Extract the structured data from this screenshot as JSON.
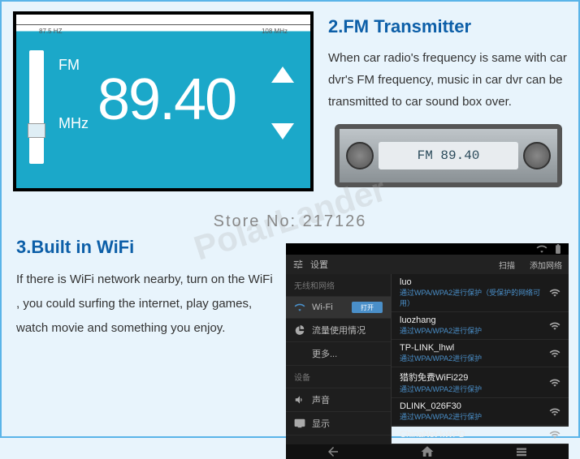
{
  "fm": {
    "title": "2.FM Transmitter",
    "text": "When car radio's frequency is same with car dvr's FM frequency, music in car dvr can be transmitted to car sound box over.",
    "scale_min": "87.5 HZ",
    "scale_max": "108 MHz",
    "label_fm": "FM",
    "label_mhz": "MHz",
    "freq": "89.40"
  },
  "stereo": {
    "disp": "FM 89.40"
  },
  "store": "Store No: 217126",
  "watermark": "PolarLander",
  "wifi": {
    "title": "3.Built in WiFi",
    "text": "If there is WiFi network nearby, turn on the WiFi , you could surfing the internet, play games, watch movie and something you enjoy."
  },
  "android": {
    "status_time": "",
    "header": "设置",
    "scan": "扫描",
    "addnet": "添加网络",
    "side": {
      "cat1": "无线和网络",
      "wifi": "Wi-Fi",
      "wifi_on": "打开",
      "data": "流量使用情况",
      "more": "更多...",
      "cat2": "设备",
      "sound": "声音",
      "display": "显示"
    },
    "nets": [
      {
        "name": "luo",
        "sub": "通过WPA/WPA2进行保护（受保护的网络可用）"
      },
      {
        "name": "luozhang",
        "sub": "通过WPA/WPA2进行保护"
      },
      {
        "name": "TP-LINK_lhwl",
        "sub": "通过WPA/WPA2进行保护"
      },
      {
        "name": "猎豹免费WiFi229",
        "sub": "通过WPA/WPA2进行保护"
      },
      {
        "name": "DLINK_026F30",
        "sub": "通过WPA/WPA2进行保护"
      },
      {
        "name": "ChinaNet-kWPD",
        "sub": ""
      }
    ]
  }
}
